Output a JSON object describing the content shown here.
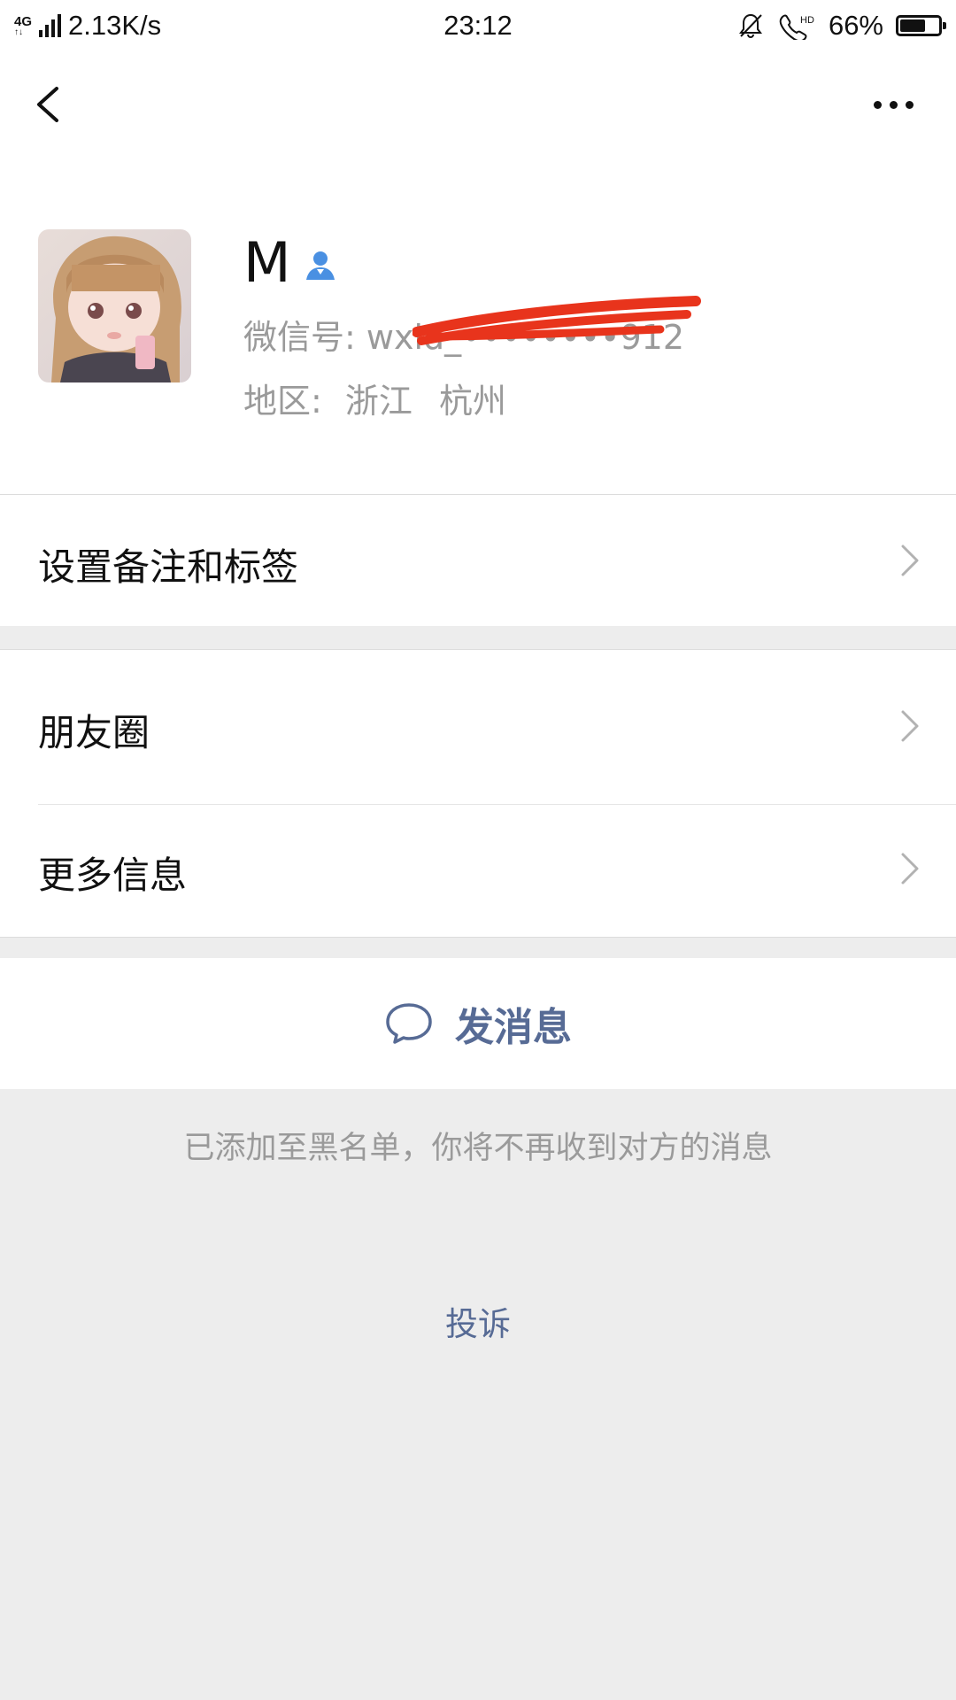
{
  "status_bar": {
    "network": "4G",
    "network2": "4G",
    "speed": "2.13K/s",
    "time": "23:12",
    "battery_percent": "66%",
    "battery_level": 0.66,
    "icons": [
      "bell-muted-icon",
      "hd-call-icon",
      "battery-icon"
    ]
  },
  "nav": {
    "back_icon": "chevron-left-icon",
    "more_icon": "more-dots-icon"
  },
  "profile": {
    "name": "M",
    "wechat_id_label": "微信号:",
    "wechat_id_value": "wxid_••••••••912",
    "region_label": "地区:",
    "region_province": "浙江",
    "region_city": "杭州"
  },
  "menu": {
    "set_remark_tags": "设置备注和标签",
    "moments": "朋友圈",
    "more_info": "更多信息"
  },
  "actions": {
    "send_message": "发消息"
  },
  "footer": {
    "blacklist_note": "已添加至黑名单，你将不再收到对方的消息",
    "complain": "投诉"
  },
  "colors": {
    "link_blue": "#576b95",
    "verify_blue": "#4a90e2",
    "redaction_red": "#e8341c",
    "background": "#ededed"
  }
}
